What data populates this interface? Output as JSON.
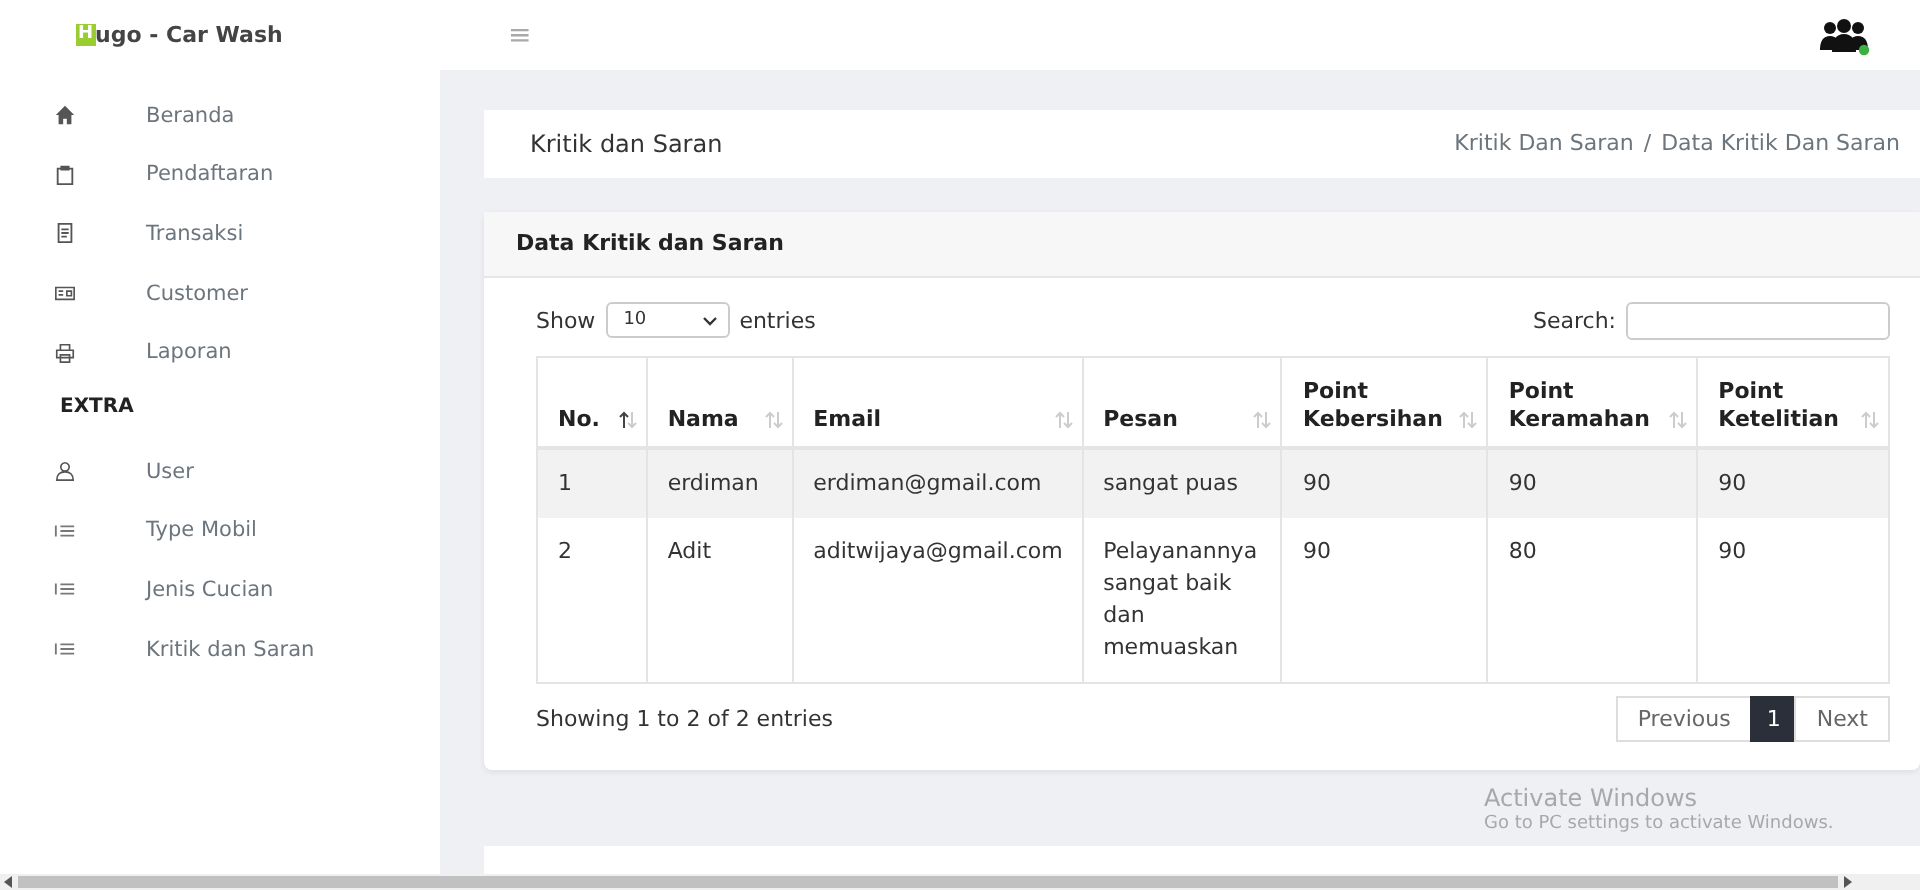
{
  "header": {
    "logo_mark": "H",
    "logo_text": "ugo - Car Wash",
    "menu_icon": "≡"
  },
  "sidebar": {
    "items": [
      {
        "label": "Beranda",
        "kind": "home"
      },
      {
        "label": "Pendaftaran",
        "kind": "clipboard"
      },
      {
        "label": "Transaksi",
        "kind": "receipt"
      },
      {
        "label": "Customer",
        "kind": "card"
      },
      {
        "label": "Laporan",
        "kind": "printer"
      }
    ],
    "section": "EXTRA",
    "extra_items": [
      {
        "label": "User",
        "kind": "user"
      },
      {
        "label": "Type Mobil",
        "kind": "list"
      },
      {
        "label": "Jenis Cucian",
        "kind": "list"
      },
      {
        "label": "Kritik dan Saran",
        "kind": "list"
      }
    ]
  },
  "page_title": "Kritik dan Saran",
  "breadcrumb": [
    "Kritik Dan Saran",
    "Data Kritik Dan Saran"
  ],
  "breadcrumb_separator": "/",
  "card": {
    "title": "Data Kritik dan Saran",
    "length_label_before": "Show",
    "length_value": "10",
    "length_label_after": "entries",
    "search_label": "Search:",
    "table": {
      "columns": [
        {
          "label": "No.",
          "sorted": true
        },
        {
          "label": "Nama",
          "sorted": false
        },
        {
          "label": "Email",
          "sorted": false
        },
        {
          "label": "Pesan",
          "sorted": false
        },
        {
          "label": "Point Kebersihan",
          "sorted": false
        },
        {
          "label": "Point Keramahan",
          "sorted": false
        },
        {
          "label": "Point Ketelitian",
          "sorted": false
        }
      ],
      "rows": [
        [
          "1",
          "erdiman",
          "erdiman@gmail.com",
          "sangat puas",
          "90",
          "90",
          "90"
        ],
        [
          "2",
          "Adit",
          "aditwijaya@gmail.com",
          "Pelayanannya sangat baik dan memuaskan",
          "90",
          "80",
          "90"
        ]
      ]
    },
    "info": "Showing 1 to 2 of 2 entries",
    "pagination": [
      {
        "label": "Previous",
        "selected": false
      },
      {
        "label": "1",
        "selected": true
      },
      {
        "label": "Next",
        "selected": false
      }
    ]
  },
  "watermark": {
    "title": "Activate Windows",
    "subtitle": "Go to PC settings to activate Windows."
  }
}
